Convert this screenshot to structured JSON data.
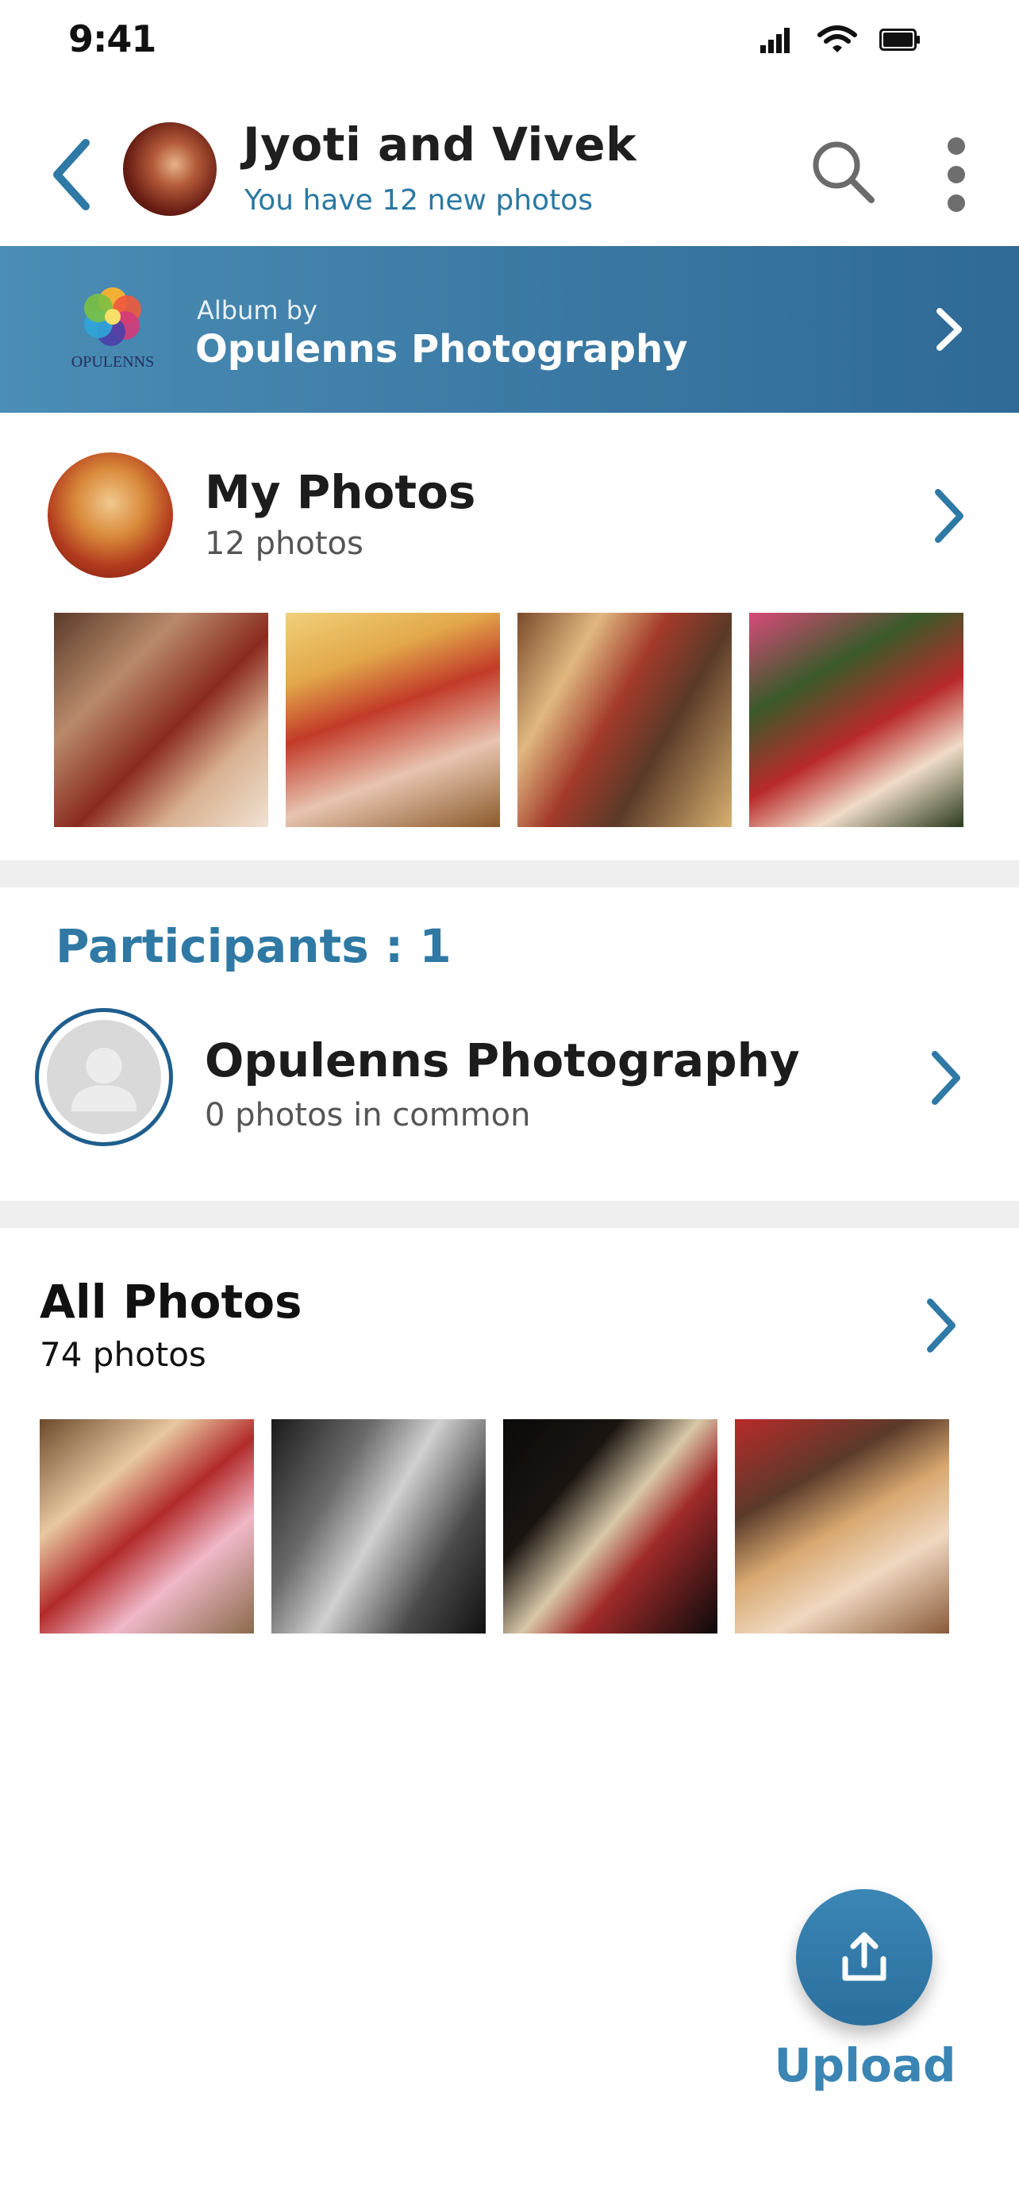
{
  "status_bar": {
    "time": "9:41"
  },
  "header": {
    "title": "Jyoti and Vivek",
    "subtitle": "You have 12 new photos"
  },
  "album": {
    "by_label": "Album by",
    "name": "Opulenns Photography",
    "logo_text": "OPULENNS"
  },
  "my_photos": {
    "title": "My Photos",
    "count": "12 photos",
    "thumbnails": [
      "wedding-photo-1",
      "wedding-photo-2",
      "wedding-photo-3",
      "wedding-photo-4"
    ]
  },
  "participants": {
    "title": "Participants : 1",
    "items": [
      {
        "name": "Opulenns Photography",
        "common": "0 photos in common"
      }
    ]
  },
  "all_photos": {
    "title": "All Photos",
    "count": "74 photos",
    "thumbnails": [
      "wedding-photo-5",
      "wedding-photo-6",
      "wedding-photo-7",
      "wedding-photo-8"
    ]
  },
  "upload": {
    "label": "Upload"
  },
  "colors": {
    "accent": "#2f79a4",
    "banner": "#3d7ca6",
    "divider": "#efefef"
  }
}
